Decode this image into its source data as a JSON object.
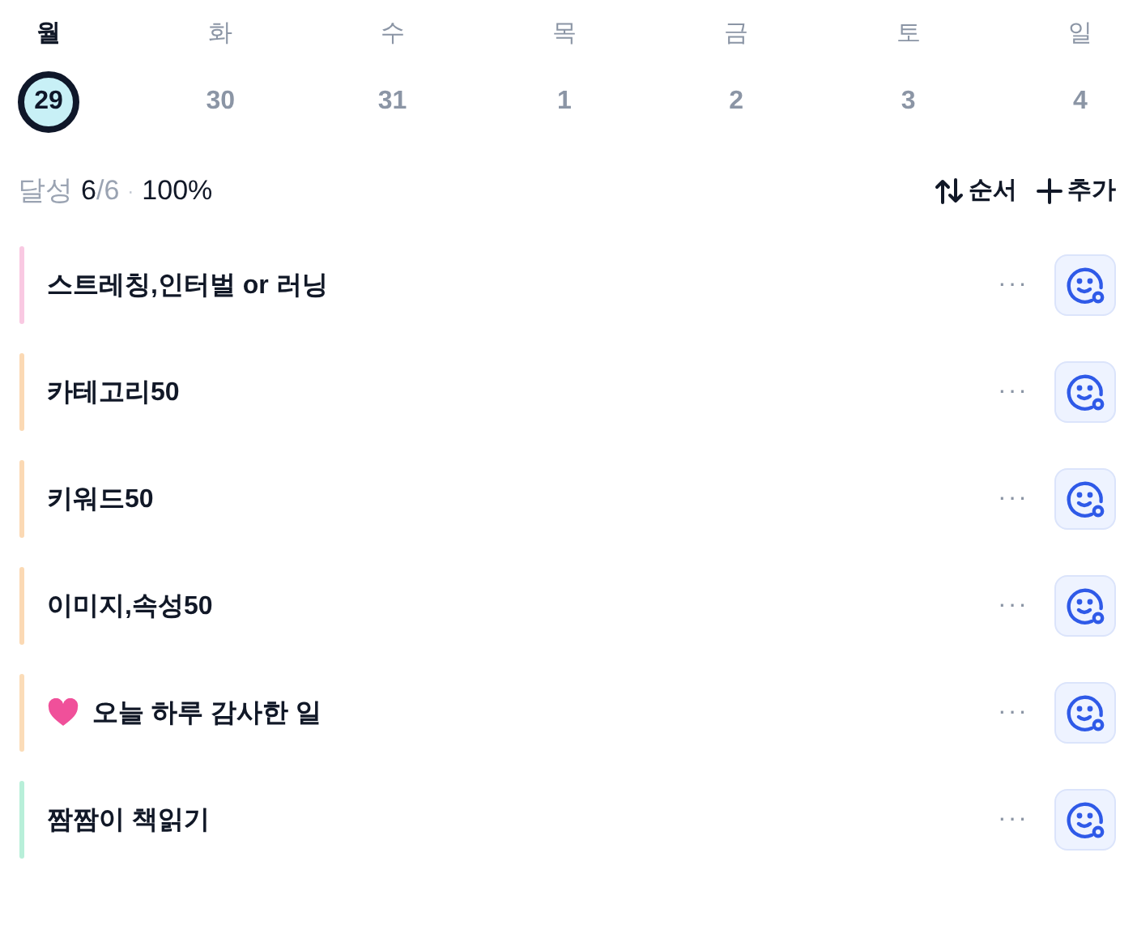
{
  "week": [
    {
      "weekday": "월",
      "date": "29",
      "selected": true
    },
    {
      "weekday": "화",
      "date": "30",
      "selected": false
    },
    {
      "weekday": "수",
      "date": "31",
      "selected": false
    },
    {
      "weekday": "목",
      "date": "1",
      "selected": false
    },
    {
      "weekday": "금",
      "date": "2",
      "selected": false
    },
    {
      "weekday": "토",
      "date": "3",
      "selected": false
    },
    {
      "weekday": "일",
      "date": "4",
      "selected": false
    }
  ],
  "summary": {
    "label": "달성",
    "done": "6",
    "total": "/6",
    "separator": "·",
    "percent": "100%"
  },
  "actions": {
    "sort": "순서",
    "add": "추가"
  },
  "habits": [
    {
      "title": "스트레칭,인터벌 or 러닝",
      "color": "#f9c9e2",
      "heart": false,
      "more": "···"
    },
    {
      "title": "카테고리50",
      "color": "#fbd9b4",
      "heart": false,
      "more": "···"
    },
    {
      "title": "키워드50",
      "color": "#fbd9b4",
      "heart": false,
      "more": "···"
    },
    {
      "title": "이미지,속성50",
      "color": "#fbd9b4",
      "heart": false,
      "more": "···"
    },
    {
      "title": "오늘 하루 감사한 일",
      "color": "#fbdcb8",
      "heart": true,
      "more": "···"
    },
    {
      "title": "짬짬이 책읽기",
      "color": "#b8efd9",
      "heart": false,
      "more": "···"
    }
  ]
}
